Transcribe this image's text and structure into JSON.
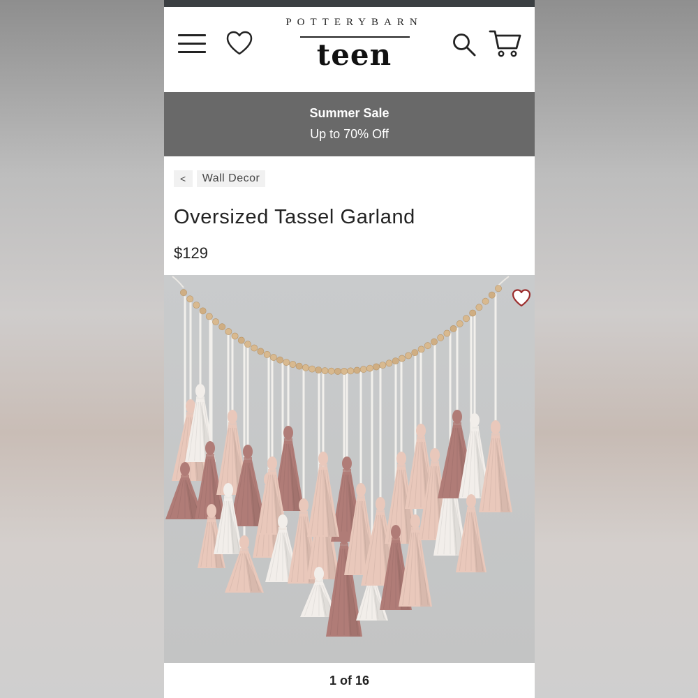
{
  "header": {
    "logo_top": "POTTERYBARN",
    "logo_bottom": "teen",
    "icons": [
      "menu-icon",
      "heart-icon",
      "search-icon",
      "cart-icon"
    ]
  },
  "promo": {
    "title": "Summer Sale",
    "subtitle": "Up to 70% Off"
  },
  "breadcrumb": {
    "back_label": "<",
    "category": "Wall Decor"
  },
  "product": {
    "title": "Oversized Tassel Garland",
    "price": "$129",
    "image_alt": "tassel garland wall hanging"
  },
  "gallery": {
    "pager": "1 of 16"
  },
  "colors": {
    "promo_bg": "#696969",
    "tassel_tones": [
      "#e9c8bb",
      "#b07c77",
      "#f2eeea",
      "#d9b9a4"
    ]
  }
}
